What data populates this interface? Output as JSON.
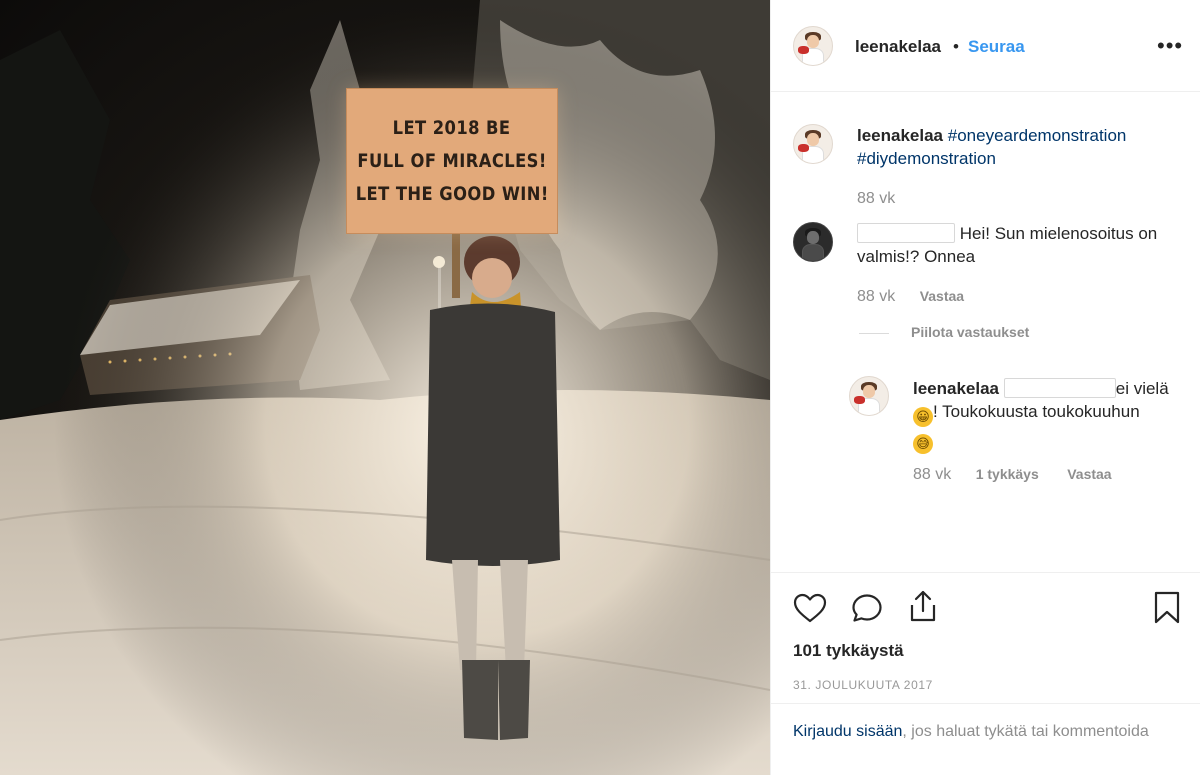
{
  "post": {
    "sign_lines": [
      "LET 2018 BE",
      "FULL OF MIRACLES!",
      "LET THE GOOD WIN!"
    ]
  },
  "header": {
    "username": "leenakelaa",
    "separator": "•",
    "follow_label": "Seuraa",
    "more_label": "•••"
  },
  "caption": {
    "username": "leenakelaa",
    "hashtag_1": "#oneyeardemonstration",
    "hashtag_2": "#diydemonstration",
    "time": "88 vk"
  },
  "comment_1": {
    "text": "Hei! Sun mielenosoitus on valmis!? Onnea",
    "time": "88 vk",
    "reply_label": "Vastaa"
  },
  "hide_replies_label": "Piilota vastaukset",
  "reply_1": {
    "username": "leenakelaa",
    "text_a": "ei vielä",
    "text_b": "! Toukokuusta toukokuuhun",
    "emoji_1": "😀",
    "emoji_2": "😅",
    "time": "88 vk",
    "likes_label": "1 tykkäys",
    "reply_label": "Vastaa"
  },
  "footer": {
    "likes_count": "101 tykkäystä",
    "date": "31. JOULUKUUTA 2017",
    "login_link": "Kirjaudu sisään",
    "login_rest": ", jos haluat tykätä tai kommentoida"
  },
  "icons": {
    "like": "heart-icon",
    "comment": "speech-bubble-icon",
    "share": "share-icon",
    "save": "bookmark-icon"
  }
}
